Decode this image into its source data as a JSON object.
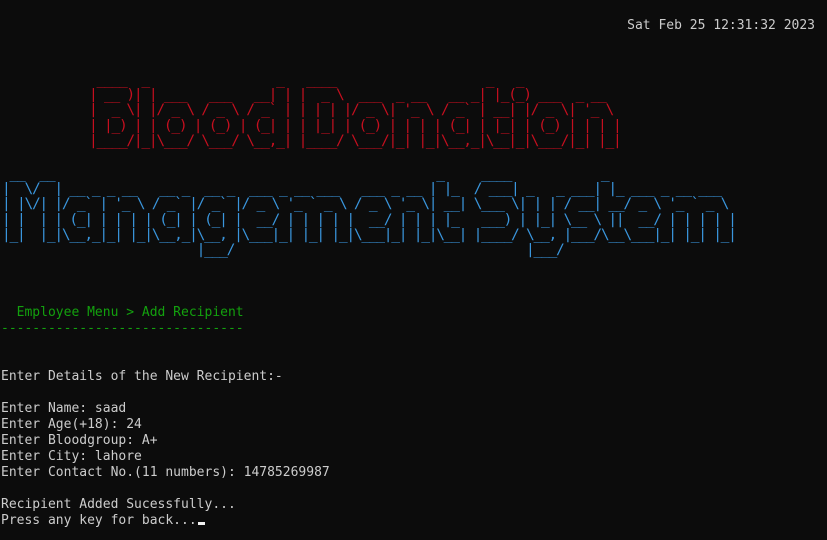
{
  "header": {
    "datetime": "Sat Feb 25 12:31:32 2023"
  },
  "banner": {
    "title_ascii": " ____  _                 _   ____                    _   _             \n| __ )| | ___   ___   __| | |  _ \\  ___  _ __   __ _| |_(_) ___  _ __  \n|  _ \\| |/ _ \\ / _ \\ / _` | | | | |/ _ \\| '_ \\ / _` | __| |/ _ \\| '_ \\ \n| |_) | | (_) | (_) | (_| | | |_| | (_) | | | | (_| | |_| | (_) | | | |\n|____/|_|\\___/ \\___/ \\__,_| |____/ \\___/|_| |_|\\__,_|\\__|_|\\___/|_| |_|",
    "subtitle_ascii": " __  __                                                   _     ____            _                 \n|  \\/  | __ _ _ __   __ _  __ _  ___ _ __ ___   ___ _ __ | |_  / ___| _   _ ___| |_ ___ _ __ ___  \n| |\\/| |/ _` | '_ \\ / _` |/ _` |/ _ \\ '_ ` _ \\ / _ \\ '_ \\| __| \\___ \\| | | / __| __/ _ \\ '_ ` _ \\ \n| |  | | (_| | | | | (_| | (_| |  __/ | | | | |  __/ | | | |_   ___) | |_| \\__ \\ ||  __/ | | | | |\n|_|  |_|\\__,_|_| |_|\\__,_|\\__, |\\___|_| |_| |_|\\___|_| |_|\\__| |____/ \\__, |___/\\__\\___|_| |_| |_|\n                          |___/                                       |___/                        "
  },
  "breadcrumb": {
    "text": "  Employee Menu > Add Recipient",
    "rule": "-------------------------------"
  },
  "form": {
    "heading": "Enter Details of the New Recipient:-",
    "name": "Enter Name: saad",
    "age": "Enter Age(+18): 24",
    "bloodgroup": "Enter Bloodgroup: A+",
    "city": "Enter City: lahore",
    "contact": "Enter Contact No.(11 numbers): 14785269987"
  },
  "status": {
    "message": "Recipient Added Sucessfully...",
    "prompt": "Press any key for back..."
  },
  "colors": {
    "background": "#0c0c0c",
    "text": "#cccccc",
    "banner_red": "#c50f1f",
    "banner_blue": "#3a96dd",
    "menu_green": "#13a10e"
  }
}
